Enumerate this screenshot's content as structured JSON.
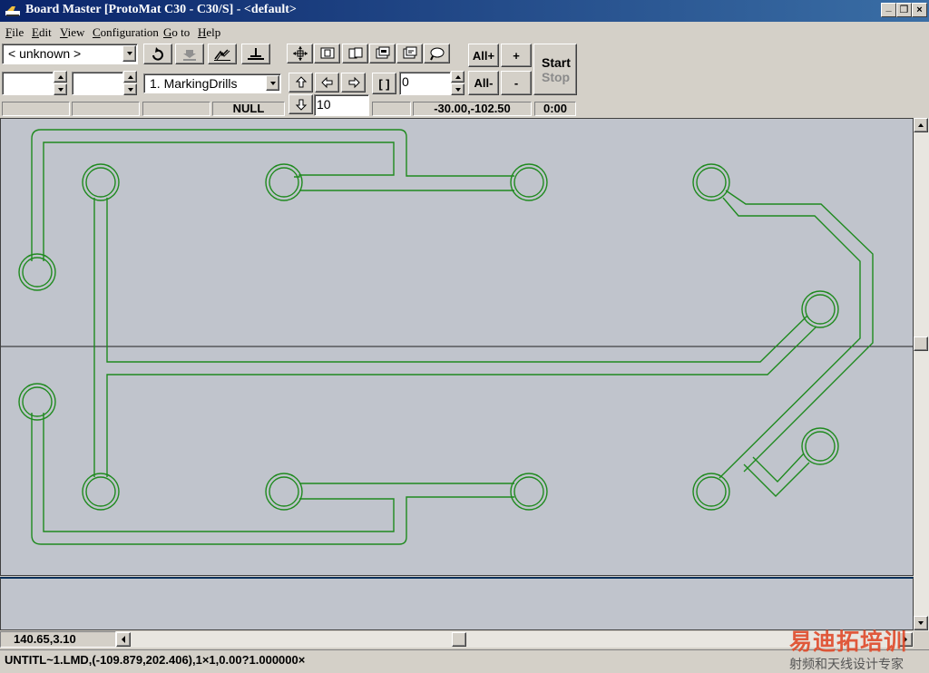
{
  "window": {
    "title": "Board Master [ProtoMat C30 - C30/S] - <default>",
    "minimize": "_",
    "restore": "❐",
    "close": "×"
  },
  "menu": [
    {
      "label": "File",
      "key": "F",
      "rest": "ile"
    },
    {
      "label": "Edit",
      "key": "E",
      "rest": "dit"
    },
    {
      "label": "View",
      "key": "V",
      "rest": "iew"
    },
    {
      "label": "Configuration",
      "key": "C",
      "rest": "onfiguration"
    },
    {
      "label": "Go to",
      "key": "G",
      "rest": "o to"
    },
    {
      "label": "Help",
      "key": "H",
      "rest": "elp"
    }
  ],
  "toolbar": {
    "machine_select": "< unknown >",
    "tool_select": "1. MarkingDrills",
    "field_a": "",
    "field_b": "",
    "counter_value": "0",
    "step_value": "10",
    "bracket_label": "[ ]",
    "all_plus": "All+",
    "all_minus": "All-",
    "plus": "+",
    "minus": "-",
    "start_label": "Start",
    "stop_label": "Stop"
  },
  "info_bar": {
    "cell1": "",
    "cell2": "",
    "cell3": "",
    "tool_status": "NULL",
    "cell5": "",
    "position": "-30.00,-102.50",
    "time": "0:00"
  },
  "cursor_coords": "140.65,3.10",
  "status_text": "UNTITL~1.LMD,(-109.879,202.406),1×1,0.00?1.000000×",
  "watermark": {
    "logo": "易迪拓培训",
    "subtitle": "射频和天线设计专家"
  },
  "colors": {
    "title_bar": "#0a246a",
    "canvas_bg": "#c0c4cc",
    "trace": "#1f8a1f",
    "face": "#d4d0c8"
  }
}
